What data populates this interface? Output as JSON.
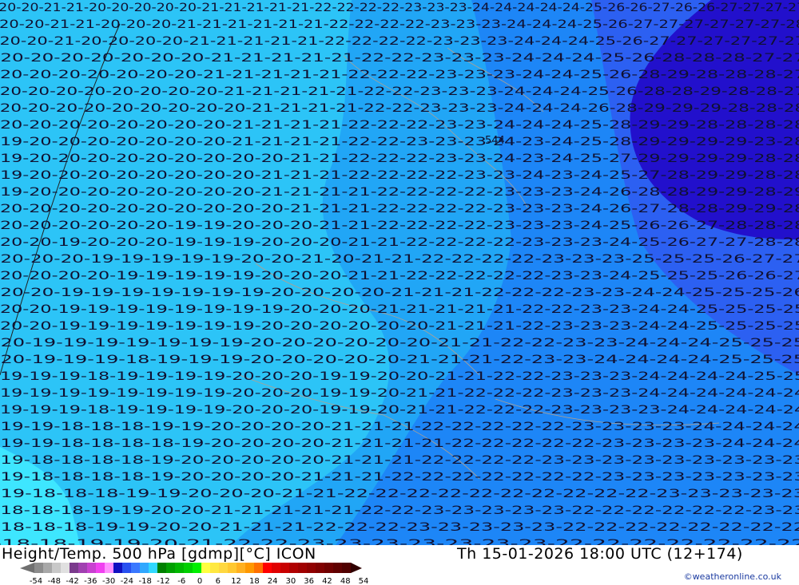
{
  "map": {
    "colors": {
      "t18": "#3ee6ff",
      "t20": "#2cc4f7",
      "t21": "#21a6f6",
      "t23": "#1d86f7",
      "t25": "#2c60f2",
      "t28": "#2210cc",
      "label": "#101030",
      "border": "#b0a090",
      "coast": "#202020"
    },
    "isolines_label": "544",
    "rows": [
      "-20-20-21-21-20-20-20-20-20-21-21-21-21-21-22-22-22-22-23-23-23-24-24-24-24-24-25-26-26-27-26-26-27-27-27-27",
      "-20-20-21-21-20-20-20-21-21-21-21-21-21-22-22-22-22-23-23-23-24-24-24-25-26-27-27-27-27-27-27-28",
      "-20-20-21-20-20-20-20-21-21-21-21-21-22-22-22-22-23-23-23-24-24-24-25-26-27-27-27-27-27-27",
      "-20-20-20-20-20-20-20-21-21-21-21-21-22-22-23-23-23-24-24-24-25-26-28-28-28-27-27",
      "-20-20-20-20-20-20-20-21-21-21-21-21-22-22-22-23-23-23-24-24-25-26-28-29-28-28-28-27",
      "-20-20-20-20-20-20-20-20-21-21-21-21-21-22-22-23-23-23-24-24-24-25-26-28-28-29-28-28-27",
      "-20-20-20-20-20-20-20-20-20-21-21-21-21-22-22-23-23-23-24-24-24-26-28-29-29-29-28-28-28",
      "-20-20-20-20-20-20-20-20-21-21-21-21-22-22-22-23-23-24-24-24-25-28-29-29-28-28-28-28",
      "-19-20-20-20-20-20-20-20-21-21-21-21-22-22-23-23-23-24-23-24-25-28-29-29-29-29-23-28",
      "-19-20-20-20-20-20-20-20-20-20-21-21-22-22-22-23-23-24-23-24-25-27-29-29-29-29-28-28",
      "-19-20-20-20-20-20-20-20-20-21-21-21-22-22-22-22-23-23-24-23-24-25-27-28-29-29-28-28",
      "-19-20-20-20-20-20-20-20-20-21-21-21-21-22-22-22-22-23-23-23-24-26-28-28-29-29-28-29",
      "-20-20-20-20-20-20-20-20-20-20-21-21-21-22-22-22-22-23-23-23-24-26-27-28-28-29-29-28",
      "-20-20-20-20-20-20-19-19-20-20-20-21-21-22-22-22-22-23-23-23-24-25-26-26-27-28-28-28",
      "-20-20-19-20-20-20-19-19-19-20-20-20-21-21-22-22-22-22-23-23-23-24-25-26-27-27-28-28",
      "-20-20-20-19-19-19-19-19-20-20-21-20-21-21-22-22-22-22-23-23-23-25-25-25-26-27-27",
      "-20-20-20-20-19-19-19-19-19-20-20-20-21-21-22-22-22-22-22-23-23-24-25-25-25-26-26-27",
      "-20-20-19-19-19-19-19-19-19-20-20-20-20-21-21-21-22-22-22-23-23-24-24-25-25-25-26",
      "-20-20-19-19-19-19-19-19-19-19-20-20-20-21-21-21-21-21-22-22-23-23-24-24-25-25-25-25",
      "-20-20-19-19-19-19-19-19-19-20-20-20-20-20-20-21-21-21-22-23-23-23-24-24-25-25-25-25",
      "-20-19-19-19-19-19-19-19-20-20-20-20-20-20-21-21-22-22-23-23-24-24-24-25-25-25",
      "-20-19-19-19-18-19-19-19-20-20-20-20-20-21-21-21-22-23-23-24-24-24-24-25-25-25",
      "-19-19-19-18-19-19-19-19-20-20-20-19-19-20-20-21-21-22-22-23-23-23-24-24-24-24-25-25",
      "-19-19-19-19-19-19-19-19-20-20-20-19-19-20-21-21-22-22-22-23-23-23-24-24-24-24-24-24",
      "-19-19-19-18-19-19-19-19-20-20-20-19-19-20-21-21-22-22-22-23-23-23-23-24-24-24-24-24",
      "-19-19-18-18-18-19-19-20-20-20-20-21-21-21-22-22-22-22-22-23-23-23-23-24-24-24-24",
      "-19-19-18-18-18-18-19-20-20-20-20-21-21-21-21-22-22-22-22-22-23-23-23-23-24-24-24",
      "-19-18-18-18-18-19-20-20-20-20-20-21-21-21-22-22-22-22-23-23-23-23-23-23-23-23-23",
      "-19-18-18-18-18-19-20-20-20-20-21-21-21-22-22-22-22-22-22-22-23-23-23-23-23-23-23",
      "-19-18-18-18-19-19-20-20-20-21-21-22-22-22-22-22-22-22-22-22-22-23-23-23-23-23",
      "-18-18-18-19-19-20-20-21-21-21-21-21-22-22-23-23-23-23-23-22-22-22-22-22-22-23-23",
      "-18-18-18-19-19-20-20-21-21-21-22-22-22-23-23-23-23-23-22-22-22-22-22-22-22-22",
      "-18-18-19-19-20-21-22-22-23-23-23-23-23-23-23-22-22-22-22-22-22-22"
    ]
  },
  "footer": {
    "title": "Height/Temp. 500 hPa [gdmp][°C] ICON",
    "datetime": "Th 15-01-2026 18:00 UTC (12+174)",
    "credit": "©weatheronline.co.uk",
    "colorbar": {
      "ticks": [
        "-54",
        "-48",
        "-42",
        "-36",
        "-30",
        "-24",
        "-18",
        "-12",
        "-6",
        "0",
        "6",
        "12",
        "18",
        "24",
        "30",
        "36",
        "42",
        "48",
        "54"
      ],
      "left_arrow": "#707070",
      "right_arrow": "#300000",
      "colors": [
        "#8c8c8c",
        "#a8a8a8",
        "#c8c8c8",
        "#e0e0e0",
        "#7a3a8c",
        "#a040b0",
        "#c840d0",
        "#f040f0",
        "#ff90ff",
        "#1010c0",
        "#2850f0",
        "#3a78ff",
        "#30a8ff",
        "#30d8ff",
        "#008000",
        "#00a000",
        "#00b800",
        "#00d000",
        "#00f000",
        "#ffff40",
        "#ffe840",
        "#ffd840",
        "#ffc830",
        "#ffb020",
        "#ff9800",
        "#ff7000",
        "#ff0000",
        "#e00000",
        "#c80000",
        "#b00000",
        "#a00000",
        "#900000",
        "#800000",
        "#700000",
        "#600000",
        "#500000"
      ]
    }
  }
}
